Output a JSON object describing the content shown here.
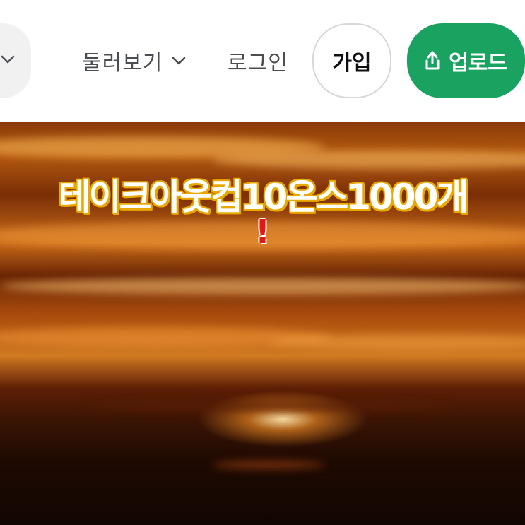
{
  "header": {
    "explore_label": "둘러보기",
    "login_label": "로그인",
    "join_label": "가입",
    "upload_label": "업로드"
  },
  "colors": {
    "accent_green": "#1aa360",
    "nav_text": "#4a4d52",
    "headline_outline": "#e8a800",
    "headline_mark": "#e01818"
  },
  "icons": {
    "search_dropdown": "chevron-down-icon",
    "explore_dropdown": "chevron-down-icon",
    "upload": "upload-icon"
  },
  "hero": {
    "headline": "테이크아웃컵10온스1000개",
    "mark": "!"
  }
}
